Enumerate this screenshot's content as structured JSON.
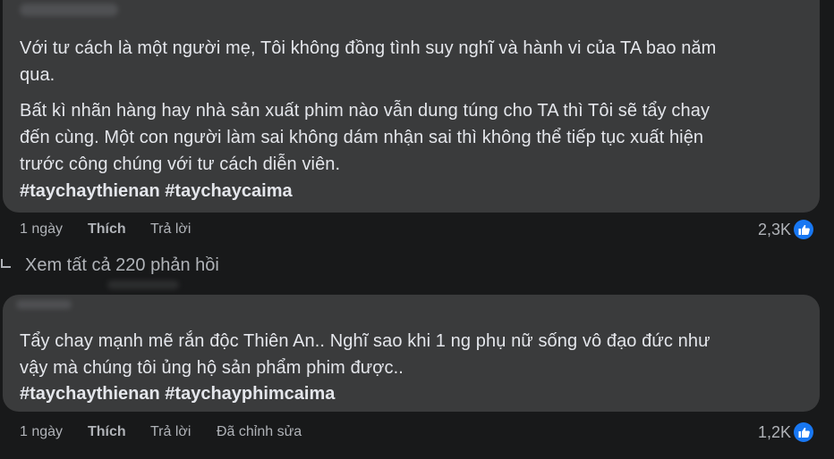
{
  "comments": [
    {
      "paragraphs": [
        "Với tư cách là một người mẹ, Tôi không đồng tình suy nghĩ và hành vi của TA bao năm qua.",
        "Bất kì nhãn hàng hay nhà sản xuất phim nào vẫn dung túng cho TA thì Tôi sẽ tẩy chay đến cùng. Một con người làm sai không dám nhận sai thì không thể tiếp tục xuất hiện trước công chúng với tư cách diễn viên."
      ],
      "lines": [
        "Với tư cách là một người mẹ, Tôi không đồng tình suy nghĩ và hành vi của TA bao năm",
        "qua.",
        "Bất kì nhãn hàng hay nhà sản xuất phim nào vẫn dung túng cho TA thì Tôi sẽ tẩy chay",
        "đến cùng. Một con người làm sai không dám nhận sai thì không thể tiếp tục xuất hiện",
        "trước công chúng với tư cách diễn viên."
      ],
      "hashtags": "#taychaythienan #taychaycaima",
      "time": "1 ngày",
      "like_label": "Thích",
      "reply_label": "Trả lời",
      "reaction_count": "2,3K",
      "reaction_icon": "thumbs-up-icon"
    },
    {
      "lines": [
        "Tẩy chay mạnh mẽ rắn độc Thiên An.. Nghĩ sao khi 1 ng phụ nữ sống vô đạo đức như",
        "vậy mà chúng tôi ủng hộ sản phẩm phim được.."
      ],
      "hashtags": "#taychaythienan #taychayphimcaima",
      "time": "1 ngày",
      "like_label": "Thích",
      "reply_label": "Trả lời",
      "edited_label": "Đã chỉnh sửa",
      "reaction_count": "1,2K",
      "reaction_icon": "thumbs-up-icon"
    }
  ],
  "view_replies": {
    "label": "Xem tất cả 220 phản hồi",
    "icon": "reply-arrow-icon"
  },
  "colors": {
    "background": "#18191a",
    "bubble": "#3a3b3c",
    "text": "#e4e6eb",
    "secondary_text": "#b0b3b8",
    "like_blue": "#1877f2"
  }
}
